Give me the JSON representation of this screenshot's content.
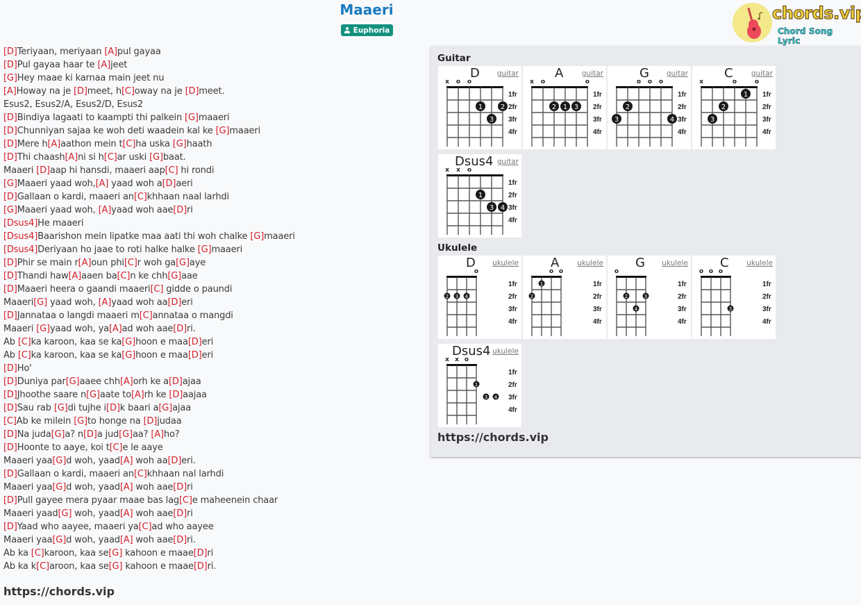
{
  "song": {
    "title": "Maaeri",
    "artist": "Euphoria",
    "artist_icon": "person-icon"
  },
  "logo": {
    "text": "chords.vip",
    "subtitle": "Chord Song Lyric"
  },
  "colors": {
    "title": "#1a7bc0",
    "badge": "#13917e",
    "chord": "#d6202a",
    "panel": "#e8eaed"
  },
  "lyrics": [
    [
      [
        "D",
        "Teriyaan, meriyaan "
      ],
      [
        "A",
        "pul gayaa"
      ]
    ],
    [
      [
        "D",
        "Pul gayaa haar te "
      ],
      [
        "A",
        "jeet"
      ]
    ],
    [
      [
        "G",
        "Hey maae ki karnaa main jeet nu"
      ]
    ],
    [
      [
        "A",
        "Howay na je "
      ],
      [
        "D",
        "meet, h"
      ],
      [
        "C",
        "oway na je "
      ],
      [
        "D",
        "meet."
      ]
    ],
    [
      [
        "",
        "Esus2, Esus2/A, Esus2/D, Esus2"
      ]
    ],
    [
      [
        "D",
        "Bindiya lagaati to kaampti thi palkein "
      ],
      [
        "G",
        "maaeri"
      ]
    ],
    [
      [
        "D",
        "Chunniyan sajaa ke woh deti waadein kal ke "
      ],
      [
        "G",
        "maaeri"
      ]
    ],
    [
      [
        "D",
        "Mere h"
      ],
      [
        "A",
        "aathon mein t"
      ],
      [
        "C",
        "ha uska "
      ],
      [
        "G",
        "haath"
      ]
    ],
    [
      [
        "D",
        "Thi chaash"
      ],
      [
        "A",
        "ni si h"
      ],
      [
        "C",
        "ar uski "
      ],
      [
        "G",
        "baat."
      ]
    ],
    [
      [
        "",
        "Maaeri "
      ],
      [
        "D",
        "aap hi hansdi, maaeri aap"
      ],
      [
        "C",
        " hi rondi"
      ]
    ],
    [
      [
        "G",
        "Maaeri yaad woh,"
      ],
      [
        "A",
        " yaad woh a"
      ],
      [
        "D",
        "aeri"
      ]
    ],
    [
      [
        "D",
        "Gallaan o kardi, maaeri an"
      ],
      [
        "C",
        "khhaan naal larhdi"
      ]
    ],
    [
      [
        "G",
        "Maaeri yaad woh, "
      ],
      [
        "A",
        "yaad woh aae"
      ],
      [
        "D",
        "ri"
      ]
    ],
    [
      [
        "Dsus4",
        "He maaeri"
      ]
    ],
    [
      [
        "Dsus4",
        "Baarishon mein lipatke maa aati thi woh chalke "
      ],
      [
        "G",
        "maaeri"
      ]
    ],
    [
      [
        "Dsus4",
        "Deriyaan ho jaae to roti halke halke "
      ],
      [
        "G",
        "maaeri"
      ]
    ],
    [
      [
        "D",
        "Phir se main r"
      ],
      [
        "A",
        "oun phi"
      ],
      [
        "C",
        "r woh ga"
      ],
      [
        "G",
        "aye"
      ]
    ],
    [
      [
        "D",
        "Thandi haw"
      ],
      [
        "A",
        "aaen ba"
      ],
      [
        "C",
        "n ke chh"
      ],
      [
        "G",
        "aae"
      ]
    ],
    [
      [
        "D",
        "Maaeri heera o gaandi maaeri"
      ],
      [
        "C",
        " gidde o paundi"
      ]
    ],
    [
      [
        "",
        "Maaeri"
      ],
      [
        "G",
        " yaad woh, "
      ],
      [
        "A",
        "yaad woh aa"
      ],
      [
        "D",
        "eri"
      ]
    ],
    [
      [
        "D",
        "Jannataa o langdi maaeri m"
      ],
      [
        "C",
        "annataa o mangdi"
      ]
    ],
    [
      [
        "",
        "Maaeri "
      ],
      [
        "G",
        "yaad woh, ya"
      ],
      [
        "A",
        "ad woh aae"
      ],
      [
        "D",
        "ri."
      ]
    ],
    [
      [
        "",
        "Ab "
      ],
      [
        "C",
        "ka karoon, kaa se ka"
      ],
      [
        "G",
        "hoon e maa"
      ],
      [
        "D",
        "eri"
      ]
    ],
    [
      [
        "",
        "Ab "
      ],
      [
        "C",
        "ka karoon, kaa se ka"
      ],
      [
        "G",
        "hoon e maa"
      ],
      [
        "D",
        "eri"
      ]
    ],
    [
      [
        "D",
        "Ho'"
      ]
    ],
    [
      [
        "D",
        "Duniya par"
      ],
      [
        "G",
        "aaee chh"
      ],
      [
        "A",
        "orh ke a"
      ],
      [
        "D",
        "ajaa"
      ]
    ],
    [
      [
        "D",
        "Jhoothe saare n"
      ],
      [
        "G",
        "aate to"
      ],
      [
        "A",
        "rh ke "
      ],
      [
        "D",
        "aajaa"
      ]
    ],
    [
      [
        "D",
        "Sau rab "
      ],
      [
        "G",
        "di tujhe i"
      ],
      [
        "D",
        "k baari a"
      ],
      [
        "G",
        "ajaa"
      ]
    ],
    [
      [
        "C",
        "Ab ke milein "
      ],
      [
        "G",
        "to honge na "
      ],
      [
        "D",
        "judaa"
      ]
    ],
    [
      [
        "D",
        "Na juda"
      ],
      [
        "G",
        "a? n"
      ],
      [
        "D",
        "a jud"
      ],
      [
        "G",
        "aa? "
      ],
      [
        "A",
        "ho?"
      ]
    ],
    [
      [
        "D",
        "Hoonte to aaye, koi t"
      ],
      [
        "C",
        "e le aaye"
      ]
    ],
    [
      [
        "",
        "Maaeri yaa"
      ],
      [
        "G",
        "d woh, yaad"
      ],
      [
        "A",
        " woh aa"
      ],
      [
        "D",
        "eri."
      ]
    ],
    [
      [
        "D",
        "Gallaan o kardi, maaeri an"
      ],
      [
        "C",
        "khhaan nal larhdi"
      ]
    ],
    [
      [
        "",
        "Maaeri yaa"
      ],
      [
        "G",
        "d woh, yaad"
      ],
      [
        "A",
        " woh aae"
      ],
      [
        "D",
        "ri"
      ]
    ],
    [
      [
        "D",
        "Pull gayee mera pyaar maae bas lag"
      ],
      [
        "C",
        "e maheenein chaar"
      ]
    ],
    [
      [
        "",
        "Maaeri yaad"
      ],
      [
        "G",
        " woh, yaad"
      ],
      [
        "A",
        " woh aae"
      ],
      [
        "D",
        "ri"
      ]
    ],
    [
      [
        "D",
        "Yaad who aayee, maaeri ya"
      ],
      [
        "C",
        "ad who aayee"
      ]
    ],
    [
      [
        "",
        "Maaeri yaa"
      ],
      [
        "G",
        "d woh, yaad"
      ],
      [
        "A",
        " woh aae"
      ],
      [
        "D",
        "ri."
      ]
    ],
    [
      [
        "",
        "Ab ka "
      ],
      [
        "C",
        "karoon, kaa se"
      ],
      [
        "G",
        " kahoon e maae"
      ],
      [
        "D",
        "ri"
      ]
    ],
    [
      [
        "",
        "Ab ka k"
      ],
      [
        "C",
        "aroon, kaa se"
      ],
      [
        "G",
        " kahoon e maae"
      ],
      [
        "D",
        "ri."
      ]
    ]
  ],
  "footer": {
    "url": "https://chords.vip"
  },
  "panel": {
    "guitar_label": "Guitar",
    "ukulele_label": "Ukulele",
    "url": "https://chords.vip",
    "fret_labels": [
      "1fr",
      "2fr",
      "3fr",
      "4fr"
    ],
    "guitar_chords": [
      {
        "name": "D",
        "instrument": "guitar",
        "strings": [
          "x",
          "o",
          "o",
          "",
          "",
          ""
        ],
        "fingers": [
          {
            "string": 4,
            "fret": 2,
            "finger": "1"
          },
          {
            "string": 6,
            "fret": 2,
            "finger": "2"
          },
          {
            "string": 5,
            "fret": 3,
            "finger": "3"
          }
        ]
      },
      {
        "name": "A",
        "instrument": "guitar",
        "strings": [
          "x",
          "o",
          "",
          "",
          "",
          "o"
        ],
        "fingers": [
          {
            "string": 3,
            "fret": 2,
            "finger": "2"
          },
          {
            "string": 4,
            "fret": 2,
            "finger": "1"
          },
          {
            "string": 5,
            "fret": 2,
            "finger": "3"
          }
        ]
      },
      {
        "name": "G",
        "instrument": "guitar",
        "strings": [
          "",
          "",
          "o",
          "o",
          "o",
          ""
        ],
        "fingers": [
          {
            "string": 2,
            "fret": 2,
            "finger": "2"
          },
          {
            "string": 1,
            "fret": 3,
            "finger": "3"
          },
          {
            "string": 6,
            "fret": 3,
            "finger": "4"
          }
        ]
      },
      {
        "name": "C",
        "instrument": "guitar",
        "strings": [
          "x",
          "",
          "",
          "o",
          "",
          "o"
        ],
        "fingers": [
          {
            "string": 5,
            "fret": 1,
            "finger": "1"
          },
          {
            "string": 3,
            "fret": 2,
            "finger": "2"
          },
          {
            "string": 2,
            "fret": 3,
            "finger": "3"
          }
        ]
      },
      {
        "name": "Dsus4",
        "instrument": "guitar",
        "strings": [
          "x",
          "x",
          "o",
          "",
          "",
          ""
        ],
        "fingers": [
          {
            "string": 4,
            "fret": 2,
            "finger": "1"
          },
          {
            "string": 5,
            "fret": 3,
            "finger": "3"
          },
          {
            "string": 6,
            "fret": 3,
            "finger": "4"
          }
        ]
      }
    ],
    "ukulele_chords": [
      {
        "name": "D",
        "instrument": "ukulele",
        "strings": [
          "",
          "",
          "",
          "o"
        ],
        "fingers": [
          {
            "string": 1,
            "fret": 2,
            "finger": "2"
          },
          {
            "string": 2,
            "fret": 2,
            "finger": "3"
          },
          {
            "string": 3,
            "fret": 2,
            "finger": "4"
          }
        ]
      },
      {
        "name": "A",
        "instrument": "ukulele",
        "strings": [
          "",
          "",
          "o",
          "o"
        ],
        "fingers": [
          {
            "string": 2,
            "fret": 1,
            "finger": "1"
          },
          {
            "string": 1,
            "fret": 2,
            "finger": "2"
          }
        ]
      },
      {
        "name": "G",
        "instrument": "ukulele",
        "strings": [
          "o",
          "",
          "",
          ""
        ],
        "fingers": [
          {
            "string": 2,
            "fret": 2,
            "finger": "2"
          },
          {
            "string": 4,
            "fret": 2,
            "finger": "3"
          },
          {
            "string": 3,
            "fret": 3,
            "finger": "4"
          }
        ]
      },
      {
        "name": "C",
        "instrument": "ukulele",
        "strings": [
          "o",
          "o",
          "o",
          ""
        ],
        "fingers": [
          {
            "string": 4,
            "fret": 3,
            "finger": "3"
          }
        ]
      },
      {
        "name": "Dsus4",
        "instrument": "ukulele",
        "strings": [
          "x",
          "x",
          "o",
          ""
        ],
        "fingers": [
          {
            "string": 4,
            "fret": 2,
            "finger": "1"
          },
          {
            "string": 5,
            "fret": 3,
            "finger": "3"
          },
          {
            "string": 6,
            "fret": 3,
            "finger": "4"
          }
        ]
      }
    ]
  }
}
